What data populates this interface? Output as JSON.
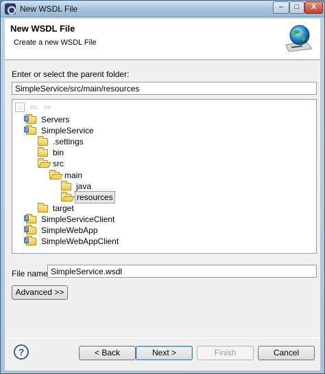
{
  "window": {
    "title": "New WSDL File",
    "controls": {
      "minimize": "–",
      "maximize": "□",
      "close": "X"
    }
  },
  "banner": {
    "title": "New WSDL File",
    "description": "Create a new WSDL File",
    "icon": "wsdl-globe-icon"
  },
  "parent_folder": {
    "label": "Enter or select the parent folder:",
    "value": "SimpleService/src/main/resources"
  },
  "tree_toolbar": {
    "home": "⌂",
    "back": "⇦",
    "forward": "⇨"
  },
  "tree": [
    {
      "label": "Servers",
      "icon": "folder-icon"
    },
    {
      "label": "SimpleService",
      "icon": "project-icon"
    },
    {
      "label": ".settings",
      "icon": "folder-icon"
    },
    {
      "label": "bin",
      "icon": "folder-icon"
    },
    {
      "label": "src",
      "icon": "open-folder-icon"
    },
    {
      "label": "main",
      "icon": "open-folder-icon"
    },
    {
      "label": "java",
      "icon": "folder-icon"
    },
    {
      "label": "resources",
      "icon": "open-folder-icon",
      "selected": true
    },
    {
      "label": "target",
      "icon": "folder-icon"
    },
    {
      "label": "SimpleServiceClient",
      "icon": "project-icon"
    },
    {
      "label": "SimpleWebApp",
      "icon": "project-icon"
    },
    {
      "label": "SimpleWebAppClient",
      "icon": "project-icon"
    }
  ],
  "file_name": {
    "label": "File name:",
    "value": "SimpleService.wsdl"
  },
  "buttons": {
    "advanced": "Advanced >>",
    "help": "?",
    "back": "< Back",
    "next": "Next >",
    "finish": "Finish",
    "cancel": "Cancel"
  }
}
